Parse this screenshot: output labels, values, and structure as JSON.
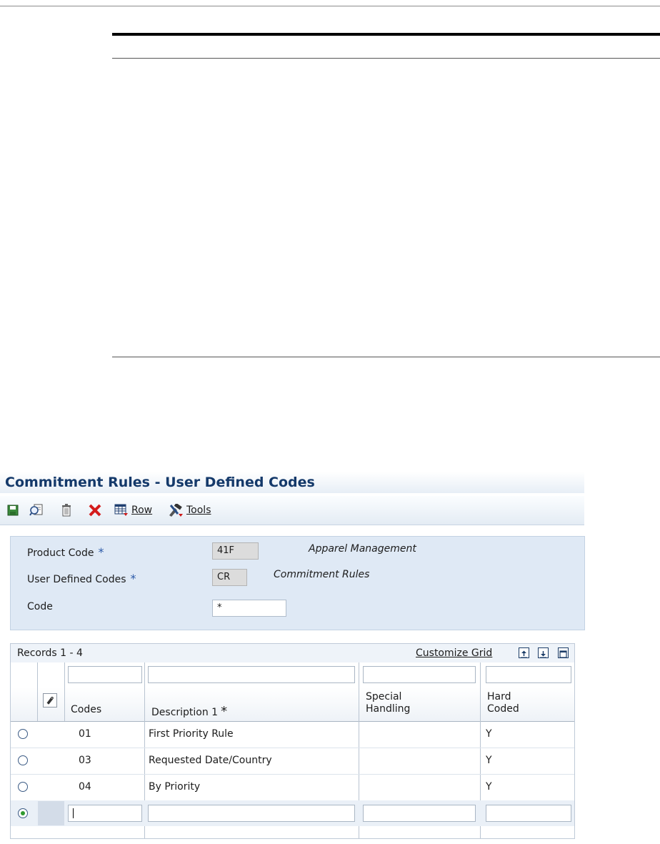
{
  "app": {
    "title": "Commitment Rules - User Defined Codes"
  },
  "toolbar": {
    "icons": [
      "save-icon",
      "search-icon",
      "delete-icon",
      "close-icon"
    ],
    "row_label": "Row",
    "tools_label": "Tools"
  },
  "form": {
    "product_code_label": "Product Code",
    "product_code_value": "41F",
    "product_code_desc": "Apparel Management",
    "udc_label": "User Defined Codes",
    "udc_value": "CR",
    "udc_desc": "Commitment Rules",
    "code_label": "Code",
    "code_value": "*",
    "required_mark": "*"
  },
  "grid": {
    "records": "Records 1 - 4",
    "customize": "Customize Grid",
    "columns": {
      "codes": "Codes",
      "description": "Description 1",
      "special_1": "Special",
      "special_2": "Handling",
      "hard_1": "Hard",
      "hard_2": "Coded"
    },
    "rows": [
      {
        "code": "01",
        "description": "First Priority Rule",
        "special": "",
        "hard": "Y"
      },
      {
        "code": "03",
        "description": "Requested Date/Country",
        "special": "",
        "hard": "Y"
      },
      {
        "code": "04",
        "description": "By Priority",
        "special": "",
        "hard": "Y"
      }
    ]
  },
  "colors": {
    "title": "#14396a",
    "panel": "#dfe9f5",
    "radio_selected": "#2f9a2f"
  }
}
